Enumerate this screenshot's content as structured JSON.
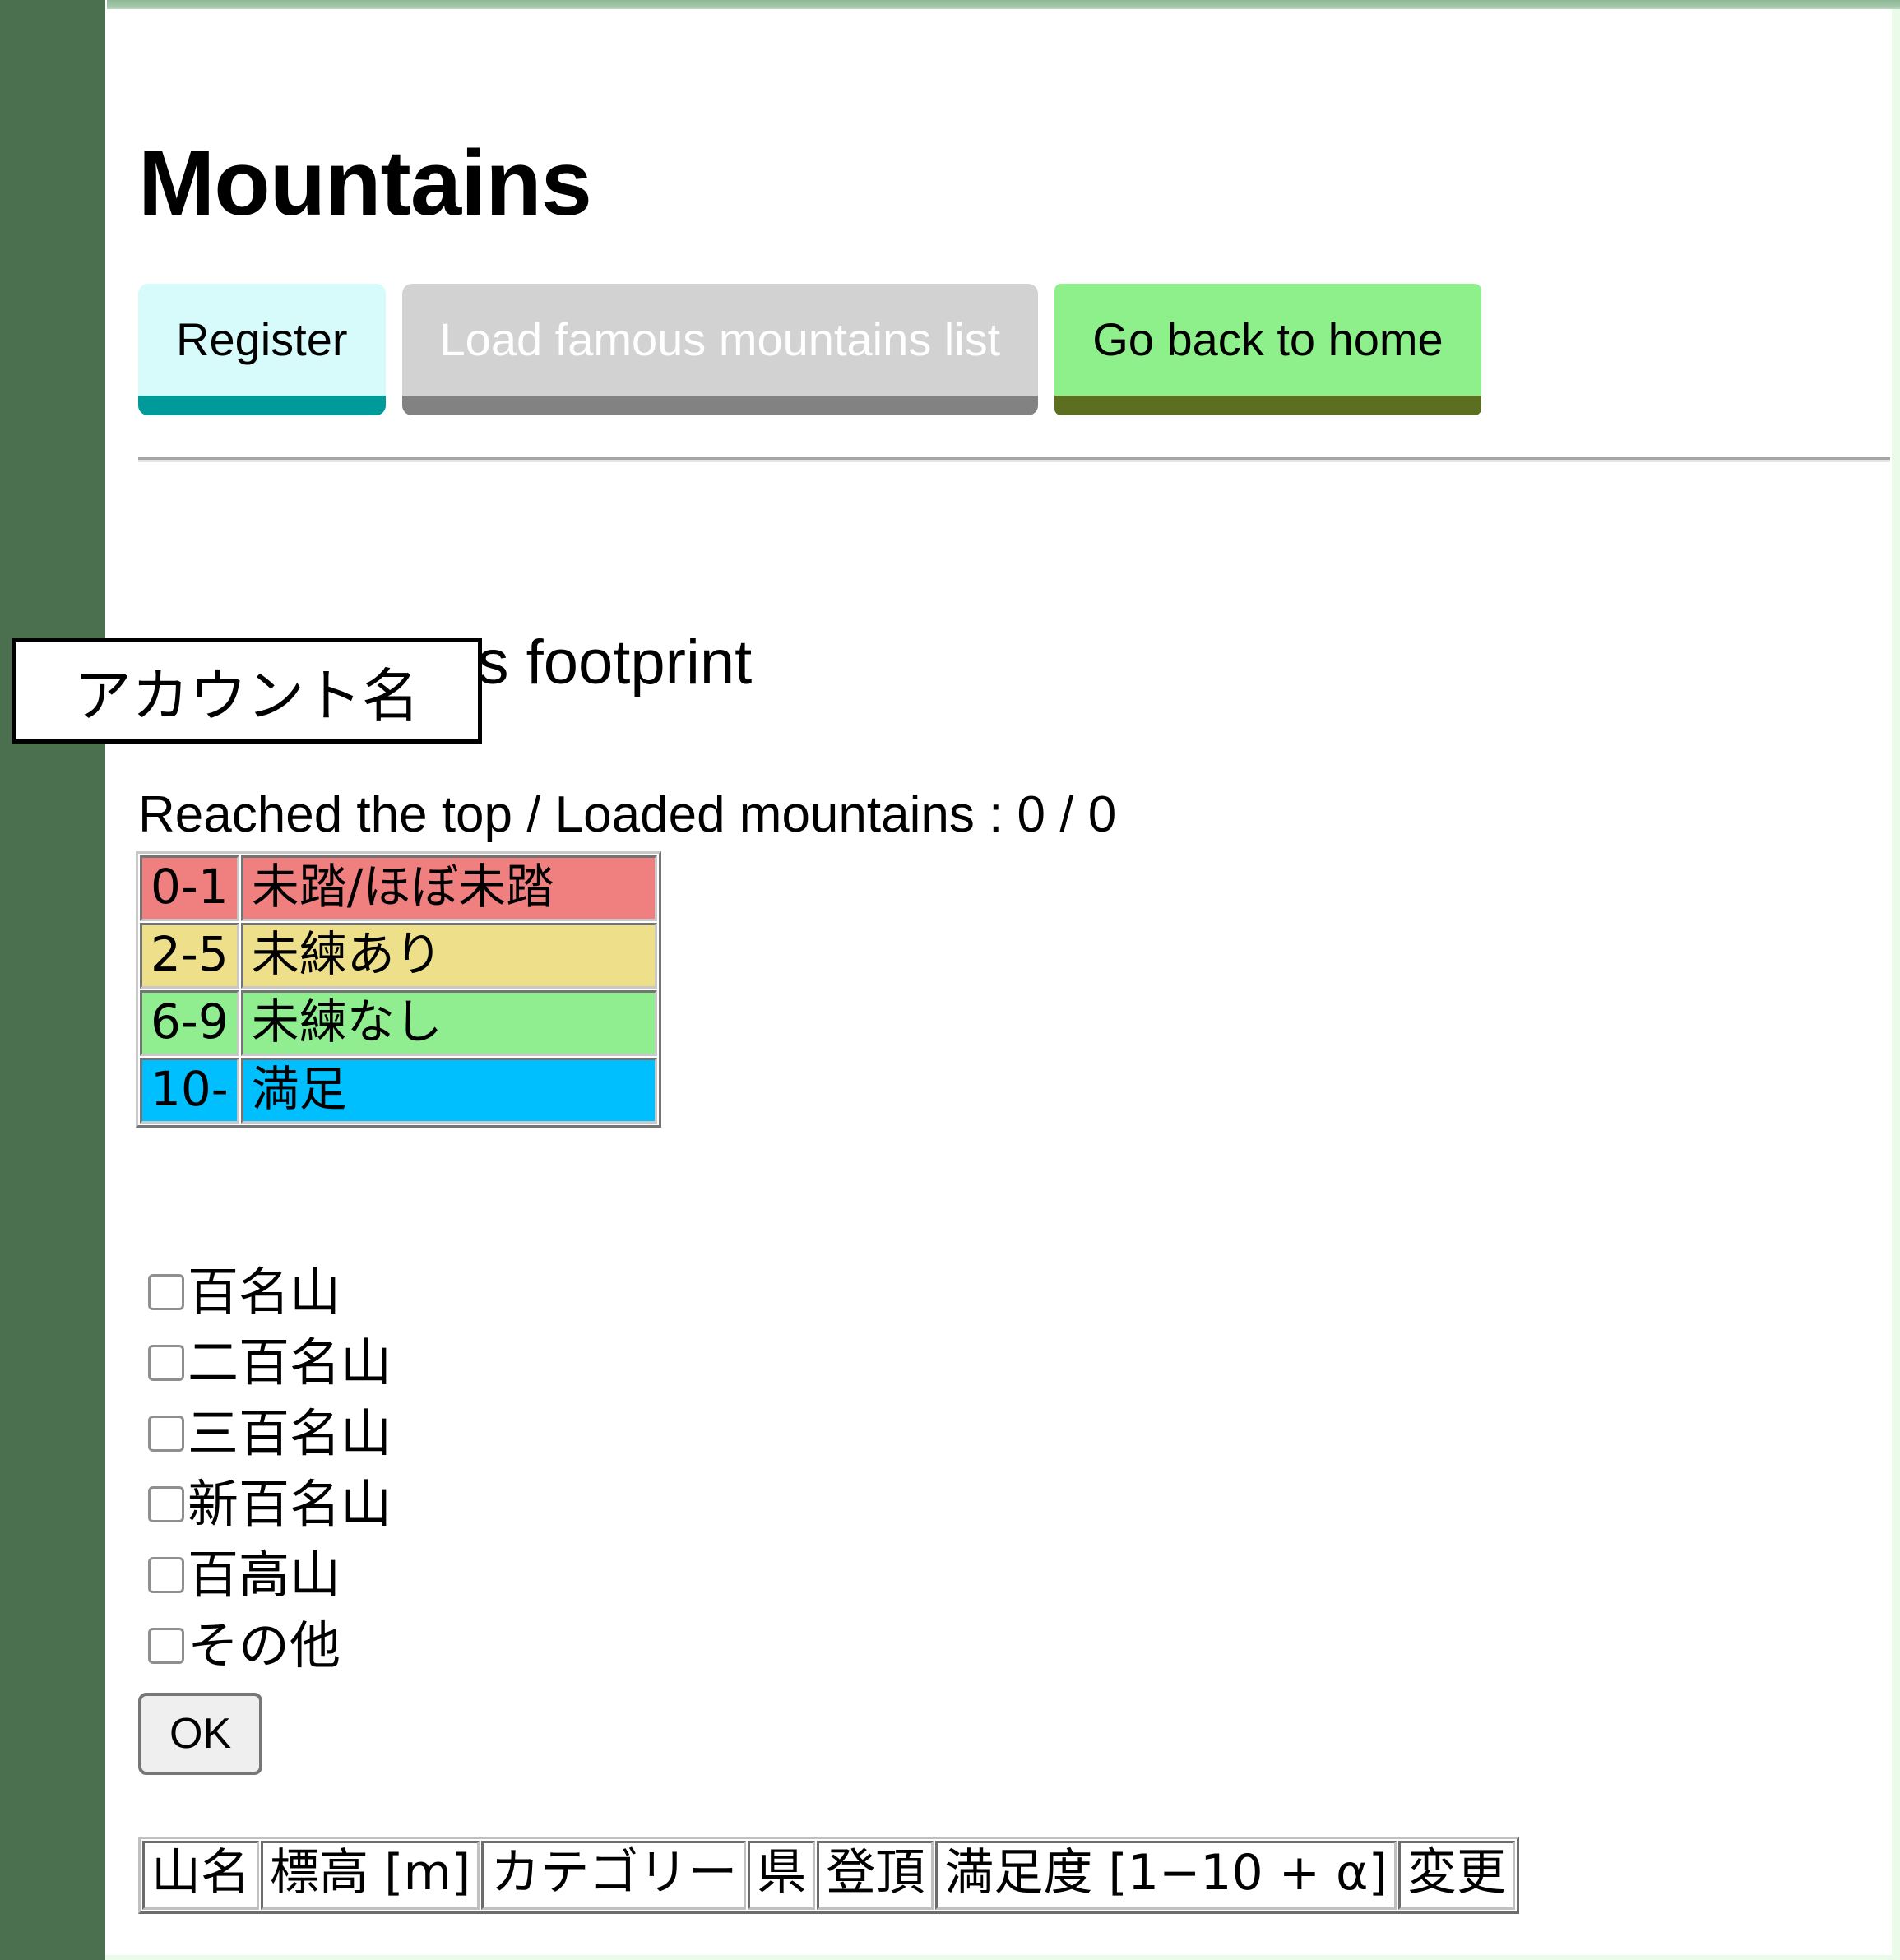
{
  "app": {
    "title": "Mountains"
  },
  "nav": {
    "register_label": "Register",
    "load_label": "Load famous mountains list",
    "home_label": "Go back to home"
  },
  "footprint": {
    "account_placeholder_label": "アカウント名",
    "heading_suffix": "'s footprint",
    "stats_label": "Reached the top / Loaded mountains : 0 / 0"
  },
  "legend": {
    "rows": [
      {
        "range": "0-1",
        "label": "未踏/ほぼ未踏",
        "color": "#f08080"
      },
      {
        "range": "2-5",
        "label": "未練あり",
        "color": "#eee08a"
      },
      {
        "range": "6-9",
        "label": "未練なし",
        "color": "#90ee90"
      },
      {
        "range": "10-",
        "label": "満足",
        "color": "#00bfff"
      }
    ]
  },
  "category_filter": {
    "items": [
      {
        "label": "百名山",
        "checked": false
      },
      {
        "label": "二百名山",
        "checked": false
      },
      {
        "label": "三百名山",
        "checked": false
      },
      {
        "label": "新百名山",
        "checked": false
      },
      {
        "label": "百高山",
        "checked": false
      },
      {
        "label": "その他",
        "checked": false
      }
    ],
    "ok_label": "OK"
  },
  "mountain_table": {
    "headers": [
      "山名",
      "標高 [m]",
      "カテゴリー",
      "県",
      "登頂",
      "満足度 [1−10 + α]",
      "変更"
    ],
    "rows": []
  },
  "colors": {
    "sidebar": "#4a7050",
    "page_frame": "#eafbe9",
    "register_accent": "#009a9a",
    "home_accent": "#5c6f20",
    "load_disabled": "#d2d2d2"
  }
}
